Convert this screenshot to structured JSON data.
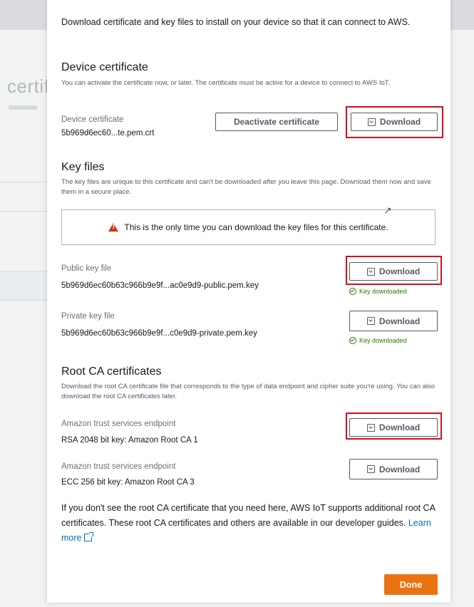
{
  "background": {
    "title_fragment": "certif"
  },
  "modal": {
    "intro": "Download certificate and key files to install on your device so that it can connect to AWS.",
    "device_certificate": {
      "heading": "Device certificate",
      "description": "You can activate the certificate now, or later. The certificate must be active for a device to connect to AWS IoT.",
      "label": "Device certificate",
      "value": "5b969d6ec60...te.pem.crt",
      "deactivate_label": "Deactivate certificate",
      "download_label": "Download"
    },
    "key_files": {
      "heading": "Key files",
      "description": "The key files are unique to this certificate and can't be downloaded after you leave this page. Download them now and save them in a secure place.",
      "alert": "This is the only time you can download the key files for this certificate.",
      "public": {
        "label": "Public key file",
        "value": "5b969d6ec60b63c966b9e9f...ac0e9d9-public.pem.key",
        "download_label": "Download",
        "status": "Key downloaded"
      },
      "private": {
        "label": "Private key file",
        "value": "5b969d6ec60b63c966b9e9f...c0e9d9-private.pem.key",
        "download_label": "Download",
        "status": "Key downloaded"
      }
    },
    "root_ca": {
      "heading": "Root CA certificates",
      "description": "Download the root CA certificate file that corresponds to the type of data endpoint and cipher suite you're using. You can also download the root CA certificates later.",
      "items": [
        {
          "label": "Amazon trust services endpoint",
          "value": "RSA 2048 bit key: Amazon Root CA 1",
          "download_label": "Download"
        },
        {
          "label": "Amazon trust services endpoint",
          "value": "ECC 256 bit key: Amazon Root CA 3",
          "download_label": "Download"
        }
      ],
      "footer": "If you don't see the root CA certificate that you need here, AWS IoT supports additional root CA certificates. These root CA certificates and others are available in our developer guides.",
      "learn_more": "Learn more"
    },
    "done_label": "Done"
  },
  "colors": {
    "highlight": "#d40c1f",
    "primary_button": "#ec7211",
    "success": "#1d8102",
    "warning": "#d13212",
    "link": "#0073bb"
  }
}
